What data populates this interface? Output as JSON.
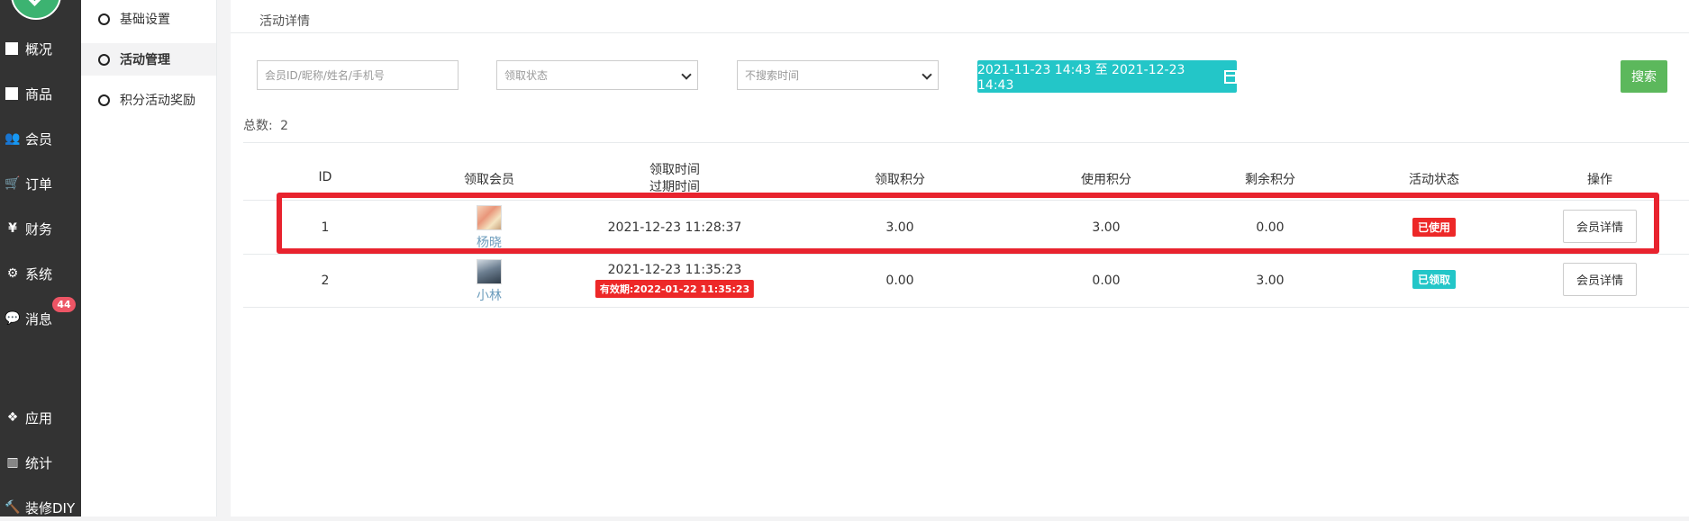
{
  "sidebar": {
    "items": [
      {
        "label": "概况",
        "icon": "dashboard-icon"
      },
      {
        "label": "商品",
        "icon": "goods-icon"
      },
      {
        "label": "会员",
        "icon": "users-icon"
      },
      {
        "label": "订单",
        "icon": "cart-icon"
      },
      {
        "label": "财务",
        "icon": "yen-icon"
      },
      {
        "label": "系统",
        "icon": "gears-icon"
      },
      {
        "label": "消息",
        "icon": "chat-icon"
      },
      {
        "label": "应用",
        "icon": "apps-icon"
      },
      {
        "label": "统计",
        "icon": "bar-chart-icon"
      },
      {
        "label": "装修DIY",
        "icon": "hammer-icon"
      }
    ],
    "message_badge": "44"
  },
  "subnav": {
    "items": [
      {
        "label": "基础设置"
      },
      {
        "label": "活动管理"
      },
      {
        "label": "积分活动奖励"
      }
    ],
    "active": "活动管理"
  },
  "main": {
    "title": "活动详情",
    "filters": {
      "member_placeholder": "会员ID/昵称/姓名/手机号",
      "status_select": "领取状态",
      "time_select": "不搜索时间",
      "date_range": "2021-11-23 14:43 至 2021-12-23 14:43",
      "search_label": "搜索"
    },
    "total_label": "总数:",
    "total_value": "2",
    "table": {
      "headers": {
        "id": "ID",
        "member": "领取会员",
        "time_top": "领取时间",
        "time_bottom": "过期时间",
        "received_points": "领取积分",
        "used_points": "使用积分",
        "remaining_points": "剩余积分",
        "status": "活动状态",
        "action": "操作"
      },
      "rows": [
        {
          "id": "1",
          "member_name": "杨晓",
          "receive_time": "2021-12-23 11:28:37",
          "expire_label": "",
          "received_points": "3.00",
          "used_points": "3.00",
          "remaining_points": "0.00",
          "status": "已使用",
          "action": "会员详情"
        },
        {
          "id": "2",
          "member_name": "小林",
          "receive_time": "2021-12-23 11:35:23",
          "expire_label": "有效期:2022-01-22 11:35:23",
          "received_points": "0.00",
          "used_points": "0.00",
          "remaining_points": "3.00",
          "status": "已领取",
          "action": "会员详情"
        }
      ]
    }
  },
  "colors": {
    "sidebar_bg": "#333333",
    "accent_teal": "#23c6c8",
    "search_green": "#5cb85c",
    "danger_red": "#ed2828",
    "highlight_red": "#e8232e"
  }
}
